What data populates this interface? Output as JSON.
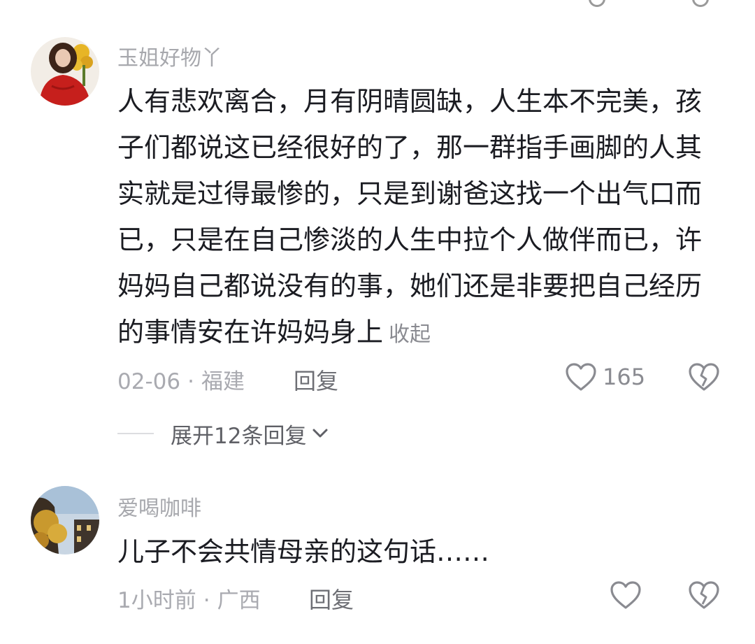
{
  "comments": [
    {
      "username": "玉姐好物丫",
      "text": "人有悲欢离合，月有阴晴圆缺，人生本不完美，孩子们都说这已经很好的了，那一群指手画脚的人其实就是过得最惨的，只是到谢爸这找一个出气口而已，只是在自己惨淡的人生中拉个人做伴而已，许妈妈自己都说没有的事，她们还是非要把自己经历的事情安在许妈妈身上",
      "collapse_label": "收起",
      "date": "02-06",
      "separator": "·",
      "location": "福建",
      "reply_label": "回复",
      "like_count": "165",
      "expand_replies_label": "展开12条回复"
    },
    {
      "username": "爱喝咖啡",
      "text": "儿子不会共情母亲的这句话……",
      "date": "1小时前",
      "separator": "·",
      "location": "广西",
      "reply_label": "回复"
    }
  ],
  "icons": {
    "like": "heart-outline-icon",
    "dislike": "broken-heart-icon",
    "expand": "chevron-down-icon"
  },
  "colors": {
    "background": "#ffffff",
    "text_primary": "#1b1c22",
    "text_secondary": "#a7a8ad"
  }
}
